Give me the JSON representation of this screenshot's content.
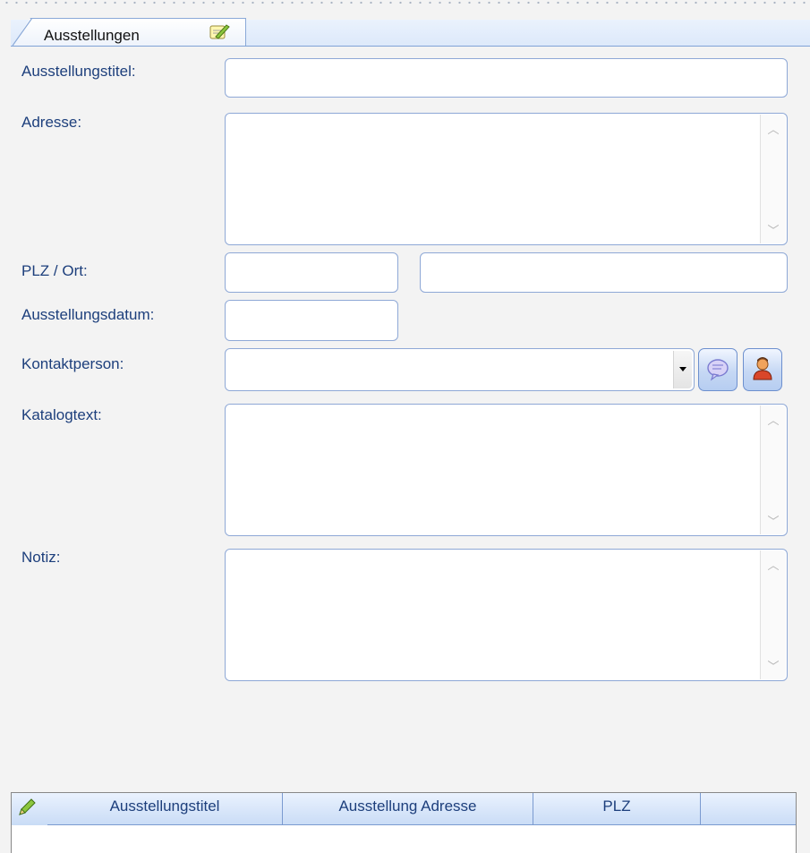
{
  "tab": {
    "label": "Ausstellungen"
  },
  "form": {
    "title_label": "Ausstellungstitel:",
    "address_label": "Adresse:",
    "plz_ort_label": "PLZ / Ort:",
    "date_label": "Ausstellungsdatum:",
    "contact_label": "Kontaktperson:",
    "catalog_label": "Katalogtext:",
    "note_label": "Notiz:"
  },
  "grid": {
    "columns": [
      "Ausstellungstitel",
      "Ausstellung Adresse",
      "PLZ",
      ""
    ]
  },
  "icons": {
    "tab_icon": "notepad-edit-icon",
    "contact_buttons": [
      "speech-bubble-icon",
      "person-icon"
    ],
    "grid_corner": "pencil-icon"
  }
}
